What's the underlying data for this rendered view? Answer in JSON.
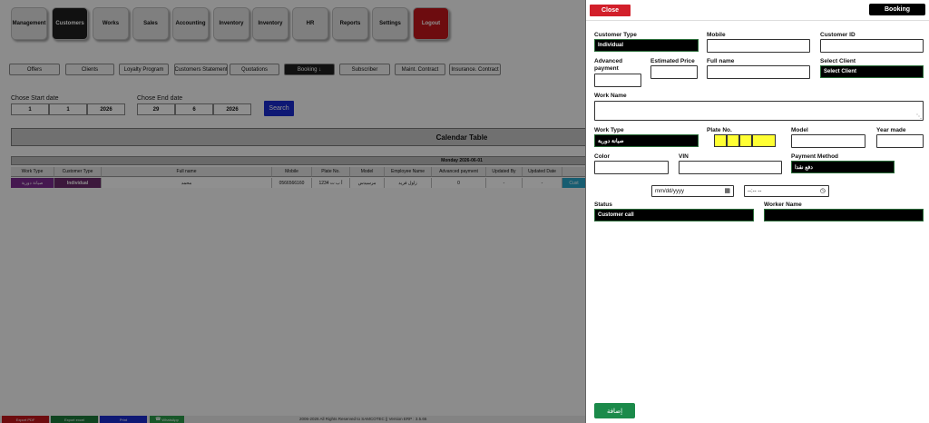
{
  "nav": {
    "items": [
      "Management",
      "Customers",
      "Works",
      "Sales",
      "Accounting",
      "Inventory",
      "Inventory",
      "HR",
      "Reports",
      "Settings",
      "Logout"
    ]
  },
  "subnav": {
    "items": [
      "Offers",
      "Clients",
      "Loyalty Program",
      "Customers Statement",
      "Quotations",
      "Booking ↓",
      "Subscriber",
      "Maint. Contract",
      "Insurance. Contract"
    ]
  },
  "filters": {
    "start_label": "Chose Start date",
    "start_day": "1",
    "start_month": "1",
    "start_year": "2026",
    "end_label": "Chose End date",
    "end_day": "29",
    "end_month": "6",
    "end_year": "2026",
    "search_label": "Search"
  },
  "calendar": {
    "title": "Calendar Table",
    "day_header": "Monday 2026-06-01",
    "columns": [
      "Work Type",
      "Customer Type",
      "Full name",
      "Mobile",
      "Plate No.",
      "Model",
      "Employee Name",
      "Advanced payment",
      "Updated By",
      "Updated Date"
    ],
    "row": [
      "صيانة دورية",
      "Individual",
      "محمد",
      "0566566160",
      "أ ب ت 1234",
      "مرسيدس",
      "زاول فريد",
      "0",
      "-",
      "-"
    ],
    "row_action": "Cust"
  },
  "footer": {
    "export_pdf": "Export PDF",
    "export_excel": "Export excel",
    "print": "Print",
    "whatsapp": "WhatsApp",
    "copyright": "2006-2026 All Rights Reserved to  SAMCOTEC || Version ERP : 3.5.66"
  },
  "panel": {
    "close_label": "Close",
    "booking_label": "Booking",
    "customer_type_label": "Customer Type",
    "customer_type_value": "Individual",
    "mobile_label": "Mobile",
    "customer_id_label": "Customer ID",
    "advanced_payment_label": "Advanced payment",
    "estimated_price_label": "Estimated Price",
    "full_name_label": "Full name",
    "select_client_label": "Select Client",
    "select_client_value": "Select Client",
    "work_name_label": "Work Name",
    "work_type_label": "Work Type",
    "work_type_value": "صيانة دورية",
    "plate_label": "Plate No.",
    "model_label": "Model",
    "year_label": "Year made",
    "color_label": "Color",
    "vin_label": "VIN",
    "payment_label": "Payment Method",
    "payment_value": "دفع نقدا",
    "date_placeholder": "mm/dd/yyyy",
    "time_placeholder": "--:-- --",
    "status_label": "Status",
    "status_value": "Customer call",
    "worker_label": "Worker Name",
    "submit_label": "إضافة"
  },
  "colors": {
    "logout": "#c3161b",
    "search": "#1a2ccf",
    "close": "#d21f2a",
    "submit": "#1b8a4a",
    "plate": "#ffff33",
    "work_type_cell": "#7b2b8f"
  }
}
